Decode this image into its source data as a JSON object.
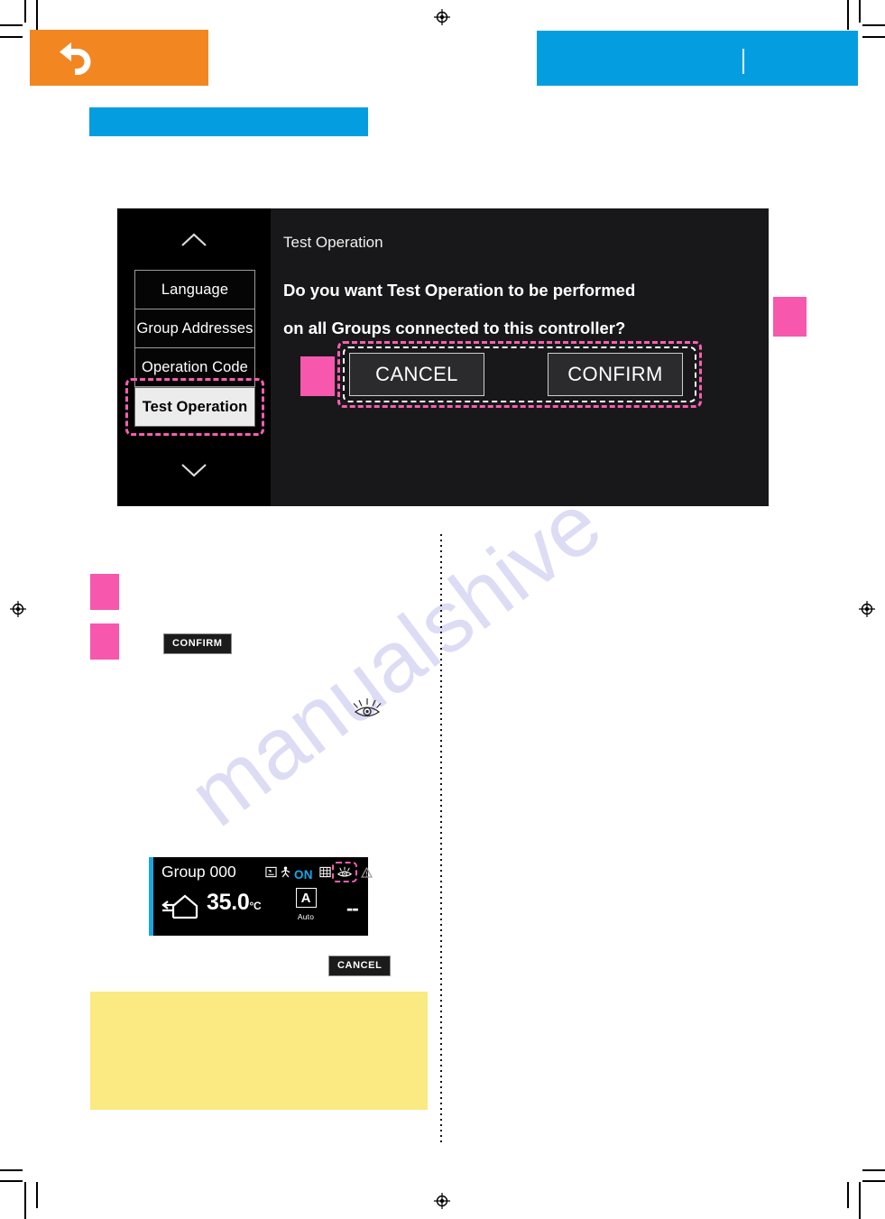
{
  "page": {
    "watermark_text": "manualshive"
  },
  "header": {
    "back_icon": "back-arrow-icon",
    "orange_band_color": "#f28722",
    "blue_band_color": "#049ee0",
    "right_band_label": "",
    "sub_band_label": ""
  },
  "device_screen": {
    "sidebar": {
      "scroll_up_icon": "chevron-up-icon",
      "scroll_down_icon": "chevron-down-icon",
      "items": [
        {
          "label": "Language",
          "selected": false
        },
        {
          "label": "Group Addresses",
          "selected": false
        },
        {
          "label": "Operation Code",
          "selected": false
        },
        {
          "label": "Test Operation",
          "selected": true
        }
      ]
    },
    "dialog": {
      "title": "Test Operation",
      "message_line1": "Do you want Test Operation to be performed",
      "message_line2": "on all Groups connected to this controller?",
      "cancel_label": "CANCEL",
      "confirm_label": "CONFIRM"
    }
  },
  "markers": {
    "color": "#f758ad",
    "step_markers": [
      "",
      ""
    ],
    "callout_markers": [
      "",
      ""
    ]
  },
  "body": {
    "confirm_chip": "CONFIRM",
    "cancel_chip": "CANCEL",
    "eye_icon": "test-operation-eye-icon",
    "note_text": ""
  },
  "group_panel": {
    "name": "Group 000",
    "power_state": "ON",
    "schedule_icon": "schedule-icon",
    "occupancy_icon": "person-icon",
    "grid_icon": "grid-icon",
    "test_operation_icon": "eye-icon",
    "warning_icon": "warning-triangle-icon",
    "mode_icon": "house-airflow-icon",
    "temperature": "35.0",
    "temperature_unit": "°C",
    "fan_letter": "A",
    "fan_label": "Auto",
    "secondary_value": "--",
    "accent_color": "#17a6e0"
  }
}
